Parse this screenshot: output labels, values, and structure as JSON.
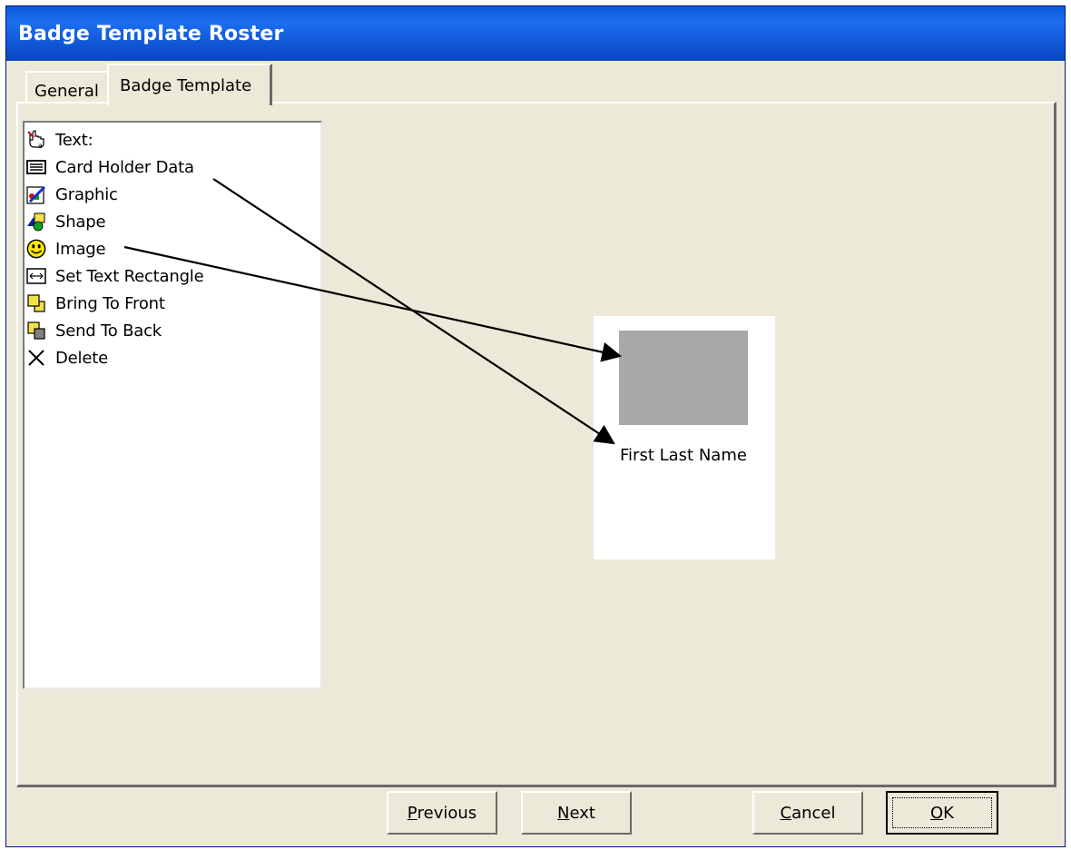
{
  "window": {
    "title": "Badge Template Roster"
  },
  "tabs": [
    {
      "label": "General",
      "active": false
    },
    {
      "label": "Badge Template",
      "active": true
    }
  ],
  "toolbox": {
    "items": [
      {
        "label": "Text:",
        "icon": "hand-pointer-icon"
      },
      {
        "label": "Card Holder Data",
        "icon": "data-list-icon"
      },
      {
        "label": "Graphic",
        "icon": "graphic-brush-icon"
      },
      {
        "label": "Shape",
        "icon": "shapes-icon"
      },
      {
        "label": "Image",
        "icon": "smiley-face-icon"
      },
      {
        "label": "Set Text Rectangle",
        "icon": "double-arrow-icon"
      },
      {
        "label": "Bring To Front",
        "icon": "bring-to-front-icon"
      },
      {
        "label": "Send To Back",
        "icon": "send-to-back-icon"
      },
      {
        "label": "Delete",
        "icon": "delete-x-icon"
      }
    ]
  },
  "badge": {
    "name_text": "First Last Name"
  },
  "buttons": {
    "previous": {
      "mnemonic": "P",
      "rest": "revious"
    },
    "next": {
      "mnemonic": "N",
      "rest": "ext"
    },
    "cancel": {
      "mnemonic": "C",
      "rest": "ancel"
    },
    "ok": {
      "mnemonic": "O",
      "rest": "K"
    }
  },
  "colors": {
    "titlebar": "#0a5bd9",
    "window_bg": "#ece9d8",
    "photo_placeholder": "#a8a7aa"
  }
}
